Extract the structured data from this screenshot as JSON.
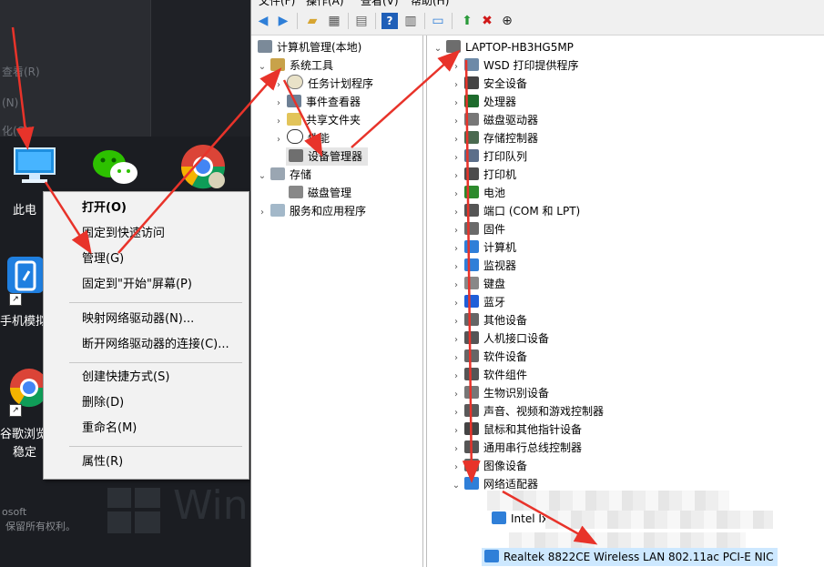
{
  "desktop": {
    "ghost_texts": [
      "查看(R)",
      "(N)",
      "化(C)"
    ],
    "icons": [
      {
        "label": "此电",
        "name": "this-pc-icon"
      },
      {
        "label": "",
        "name": "wechat-icon"
      },
      {
        "label": "",
        "name": "chrome-icon"
      },
      {
        "label": "手机模拟",
        "name": "phone-emulator-icon"
      },
      {
        "label": "谷歌浏览",
        "name": "chrome-shortcut-icon"
      },
      {
        "label": "稳定",
        "name": "chrome-shortcut-subtitle"
      }
    ],
    "watermark": "Win",
    "brand_small": "osoft",
    "rights": "保留所有权利。"
  },
  "context_menu": {
    "items": [
      {
        "label": "打开(O)",
        "bold": true
      },
      {
        "label": "固定到快速访问"
      },
      {
        "label": "管理(G)"
      },
      {
        "label": "固定到\"开始\"屏幕(P)"
      },
      {
        "label": "映射网络驱动器(N)..."
      },
      {
        "label": "断开网络驱动器的连接(C)..."
      },
      {
        "label": "创建快捷方式(S)"
      },
      {
        "label": "删除(D)"
      },
      {
        "label": "重命名(M)"
      },
      {
        "label": "属性(R)"
      }
    ]
  },
  "window": {
    "menu": [
      "文件(F)",
      "操作(A)",
      "查看(V)",
      "帮助(H)"
    ],
    "toolbar": [
      "back-arrow-icon",
      "forward-arrow-icon",
      "up-folder-icon",
      "properties-icon",
      "export-icon",
      "help-icon",
      "console-tree-icon",
      "monitor-icon",
      "update-driver-icon",
      "uninstall-icon",
      "download-icon"
    ],
    "tree": {
      "root": "计算机管理(本地)",
      "system_tools": "系统工具",
      "task_scheduler": "任务计划程序",
      "event_viewer": "事件查看器",
      "shared_folders": "共享文件夹",
      "performance": "性能",
      "device_manager": "设备管理器",
      "storage": "存储",
      "disk_management": "磁盘管理",
      "services_apps": "服务和应用程序"
    },
    "devices": {
      "computer": "LAPTOP-HB3HG5MP",
      "categories": [
        "WSD 打印提供程序",
        "安全设备",
        "处理器",
        "磁盘驱动器",
        "存储控制器",
        "打印队列",
        "打印机",
        "电池",
        "端口 (COM 和 LPT)",
        "固件",
        "计算机",
        "监视器",
        "键盘",
        "蓝牙",
        "其他设备",
        "人机接口设备",
        "软件设备",
        "软件组件",
        "生物识别设备",
        "声音、视频和游戏控制器",
        "鼠标和其他指针设备",
        "通用串行总线控制器",
        "图像设备",
        "网络适配器"
      ],
      "network_partial": "Intel Ixx",
      "highlighted_adapter": "Realtek 8822CE Wireless LAN 802.11ac PCI-E NIC"
    }
  },
  "colors": {
    "annotation_arrow": "#e8332a",
    "selection": "#cde8ff",
    "desktop_bg": "#1b1d22"
  }
}
